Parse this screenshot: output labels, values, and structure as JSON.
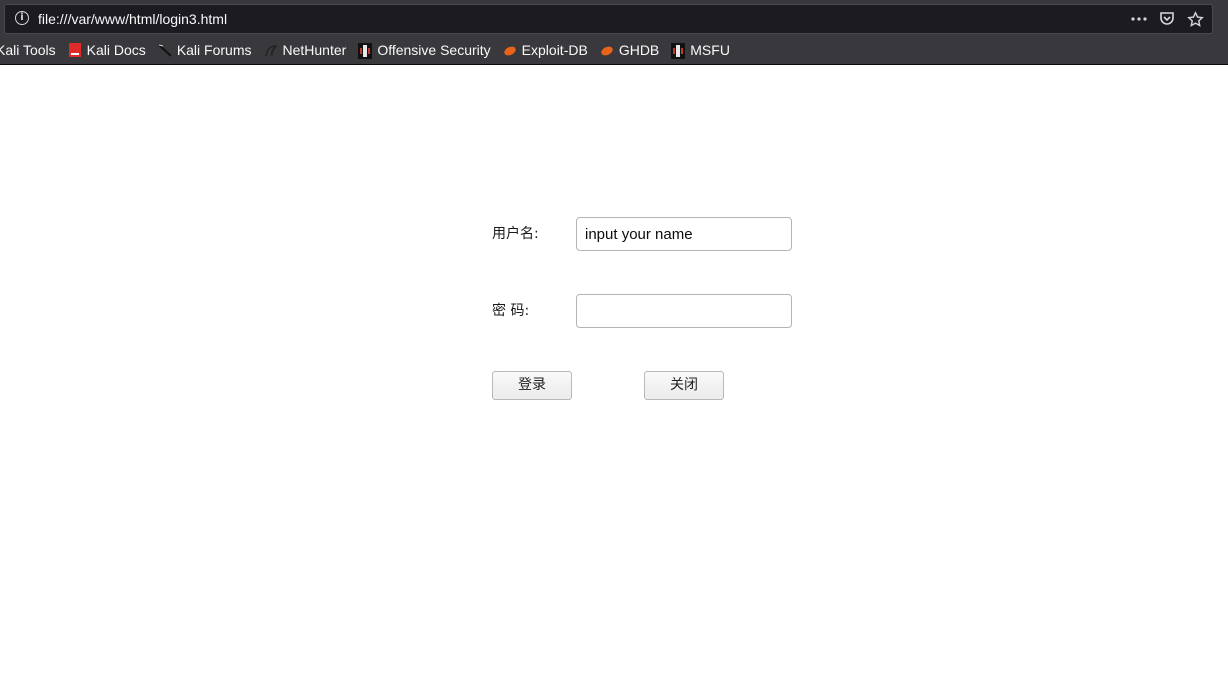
{
  "browser": {
    "url": "file:///var/www/html/login3.html",
    "info_icon": "info-icon",
    "actions": [
      "more-icon",
      "pocket-icon",
      "star-icon"
    ]
  },
  "bookmarks": [
    {
      "label": "Kali Tools",
      "icon": "kali-icon"
    },
    {
      "label": "Kali Docs",
      "icon": "kali-docs-icon"
    },
    {
      "label": "Kali Forums",
      "icon": "kali-forums-icon"
    },
    {
      "label": "NetHunter",
      "icon": "nethunter-icon"
    },
    {
      "label": "Offensive Security",
      "icon": "offsec-icon"
    },
    {
      "label": "Exploit-DB",
      "icon": "exploit-db-icon"
    },
    {
      "label": "GHDB",
      "icon": "ghdb-icon"
    },
    {
      "label": "MSFU",
      "icon": "msfu-icon"
    }
  ],
  "form": {
    "username_label": "用户名:",
    "username_value": "input your name",
    "password_label": "密 码:",
    "password_value": "",
    "login_button": "登录",
    "close_button": "关闭"
  },
  "colors": {
    "toolbar": "#38383d",
    "urlbar": "#1c1b22",
    "page": "#ffffff"
  }
}
